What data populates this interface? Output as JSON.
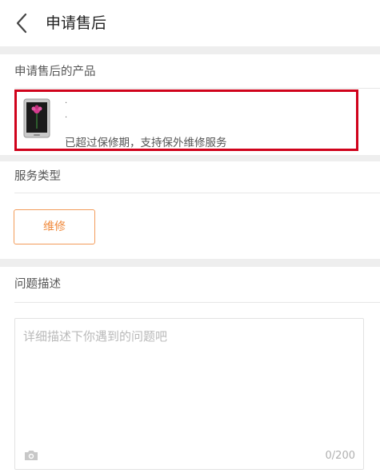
{
  "header": {
    "title": "申请售后",
    "back_icon": "chevron-left-icon"
  },
  "product_section": {
    "label": "申请售后的产品",
    "product": {
      "thumbnail_icon": "phone-thumbnail-icon",
      "name_line_1": "·",
      "name_line_2": "·",
      "status": "已超过保修期，支持保外维修服务"
    }
  },
  "service_section": {
    "label": "服务类型",
    "options": [
      "维修"
    ]
  },
  "problem_section": {
    "label": "问题描述",
    "placeholder": "详细描述下你遇到的问题吧",
    "char_count": "0/200",
    "camera_icon": "camera-icon"
  },
  "colors": {
    "highlight_border": "#d0021b",
    "accent": "#f08a3c",
    "section_gap": "#eeeeee"
  }
}
